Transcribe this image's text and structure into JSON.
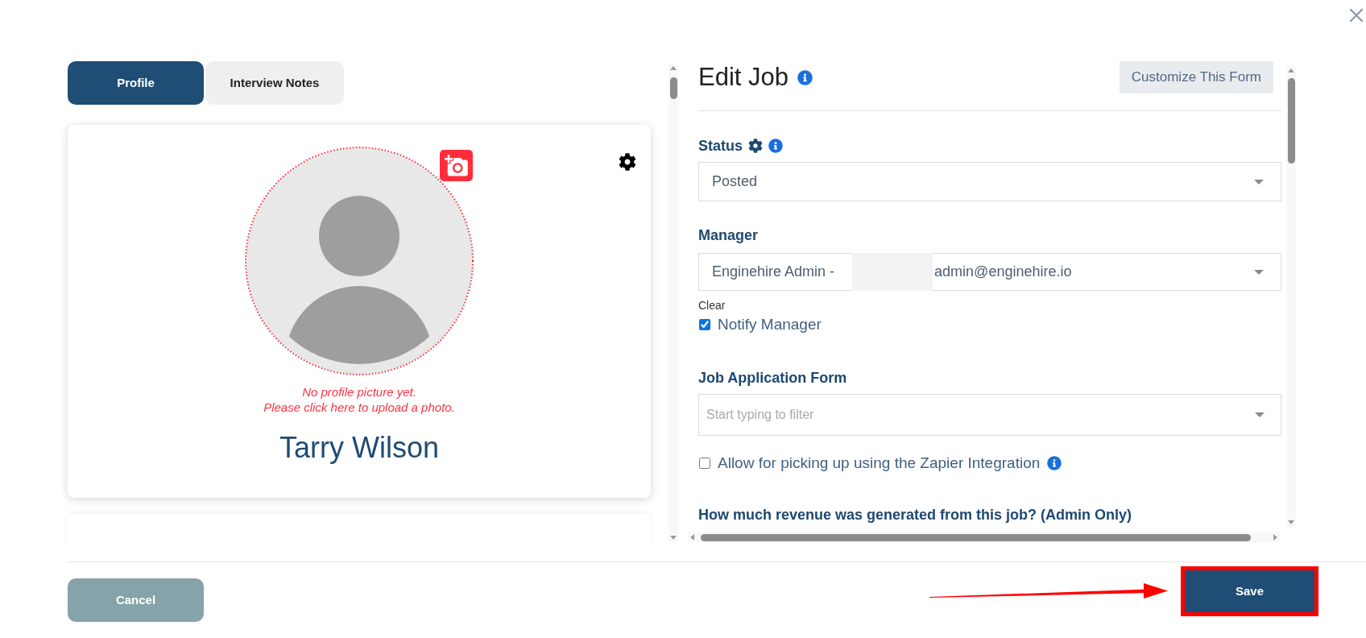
{
  "tabs": [
    {
      "label": "Profile",
      "selected": true
    },
    {
      "label": "Interview Notes",
      "selected": false
    }
  ],
  "profile": {
    "photo_hint": [
      "No profile picture yet.",
      "Please click here to upload a photo."
    ],
    "name": "Tarry Wilson"
  },
  "form": {
    "title": "Edit Job",
    "customize_button": "Customize This Form",
    "status": {
      "label": "Status",
      "value": "Posted"
    },
    "manager": {
      "label": "Manager",
      "value_start": "Enginehire Admin -",
      "value_end": "admin@enginehire.io",
      "clear_link": "Clear",
      "notify": {
        "label": "Notify Manager",
        "checked": true
      }
    },
    "application_form": {
      "label": "Job Application Form",
      "placeholder": "Start typing to filter"
    },
    "zapier": {
      "label": "Allow for picking up using the Zapier Integration",
      "checked": false
    },
    "revenue": {
      "label": "How much revenue was generated from this job? (Admin Only)"
    }
  },
  "footer": {
    "cancel": "Cancel",
    "save": "Save"
  }
}
